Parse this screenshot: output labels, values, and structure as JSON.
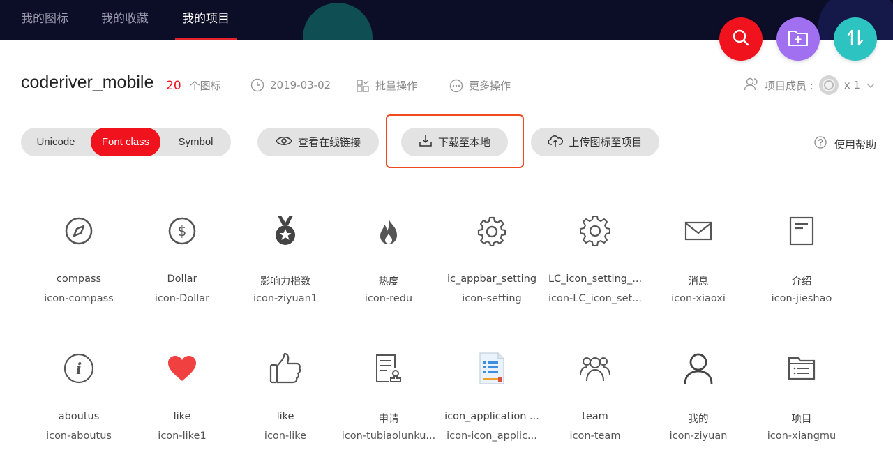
{
  "nav": {
    "tabs": [
      {
        "label": "我的图标"
      },
      {
        "label": "我的收藏"
      },
      {
        "label": "我的项目"
      }
    ]
  },
  "fabs": {
    "search": "search-icon",
    "new_folder": "folder-add-icon",
    "sort": "sort-icon"
  },
  "project": {
    "title": "coderiver_mobile",
    "icon_count": "20",
    "icon_count_unit": "个图标",
    "date": "2019-03-02",
    "batch_label": "批量操作",
    "more_label": "更多操作",
    "members_label": "项目成员 :",
    "members_count": "x 1"
  },
  "toolbar": {
    "segments": [
      "Unicode",
      "Font class",
      "Symbol"
    ],
    "active_segment": "Font class",
    "view_link_label": "查看在线链接",
    "download_label": "下载至本地",
    "upload_label": "上传图标至项目",
    "help_label": "使用帮助"
  },
  "icons": [
    {
      "name": "compass",
      "cls": "icon-compass",
      "icon": "compass-icon"
    },
    {
      "name": "Dollar",
      "cls": "icon-Dollar",
      "icon": "dollar-icon"
    },
    {
      "name": "影响力指数",
      "cls": "icon-ziyuan1",
      "icon": "medal-icon"
    },
    {
      "name": "热度",
      "cls": "icon-redu",
      "icon": "flame-icon"
    },
    {
      "name": "ic_appbar_setting",
      "cls": "icon-setting",
      "icon": "gear-icon"
    },
    {
      "name": "LC_icon_setting_...",
      "cls": "icon-LC_icon_set...",
      "icon": "gear-icon"
    },
    {
      "name": "消息",
      "cls": "icon-xiaoxi",
      "icon": "mail-icon"
    },
    {
      "name": "介绍",
      "cls": "icon-jieshao",
      "icon": "document-icon"
    },
    {
      "name": "aboutus",
      "cls": "icon-aboutus",
      "icon": "info-icon"
    },
    {
      "name": "like",
      "cls": "icon-like1",
      "icon": "heart-icon"
    },
    {
      "name": "like",
      "cls": "icon-like",
      "icon": "thumbs-up-icon"
    },
    {
      "name": "申请",
      "cls": "icon-tubiaolunku...",
      "icon": "application-form-icon"
    },
    {
      "name": "icon_application ...",
      "cls": "icon-icon_applic...",
      "icon": "application-list-icon"
    },
    {
      "name": "team",
      "cls": "icon-team",
      "icon": "team-icon"
    },
    {
      "name": "我的",
      "cls": "icon-ziyuan",
      "icon": "user-icon"
    },
    {
      "name": "项目",
      "cls": "icon-xiangmu",
      "icon": "project-icon"
    }
  ],
  "colors": {
    "accent": "#f0131e",
    "nav_bg": "#0c0d26",
    "fab_purple": "#a070f0",
    "fab_teal": "#2cc3c0",
    "highlight": "#f0491e"
  }
}
